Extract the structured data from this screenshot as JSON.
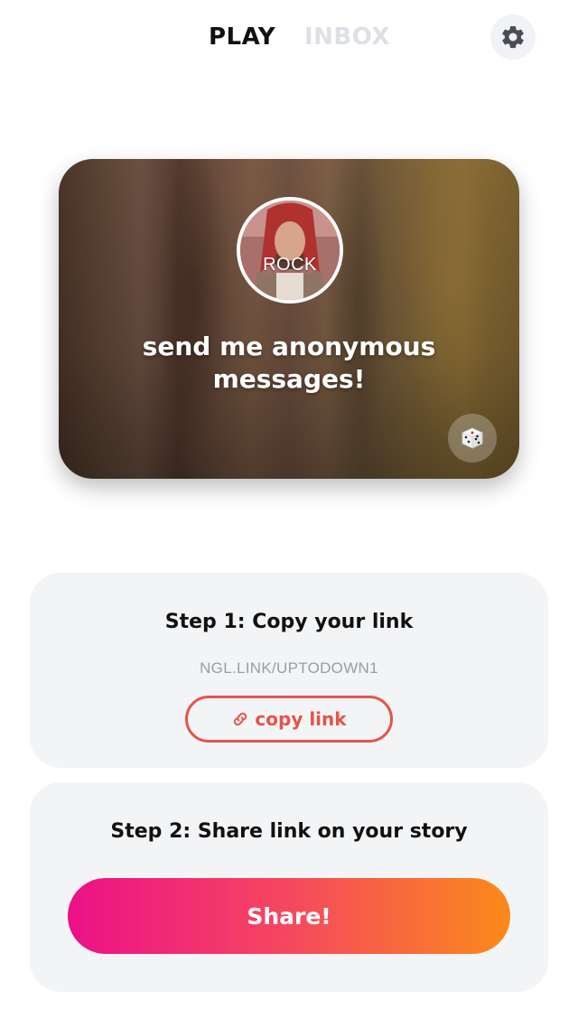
{
  "header": {
    "tabs": [
      {
        "label": "PLAY",
        "active": true
      },
      {
        "label": "INBOX",
        "active": false
      }
    ],
    "settings_icon": "gear-icon"
  },
  "card": {
    "avatar_text": "ROCK",
    "title": "send me anonymous messages!",
    "dice_icon": "dice-icon"
  },
  "step1": {
    "title": "Step 1: Copy your link",
    "link": "NGL.LINK/UPTODOWN1",
    "copy_label": "copy link",
    "copy_icon": "link-icon"
  },
  "step2": {
    "title": "Step 2: Share link on your story",
    "share_label": "Share!"
  },
  "colors": {
    "accent_red": "#e5534b",
    "share_gradient_start": "#ec1187",
    "share_gradient_end": "#fb8a1a"
  }
}
